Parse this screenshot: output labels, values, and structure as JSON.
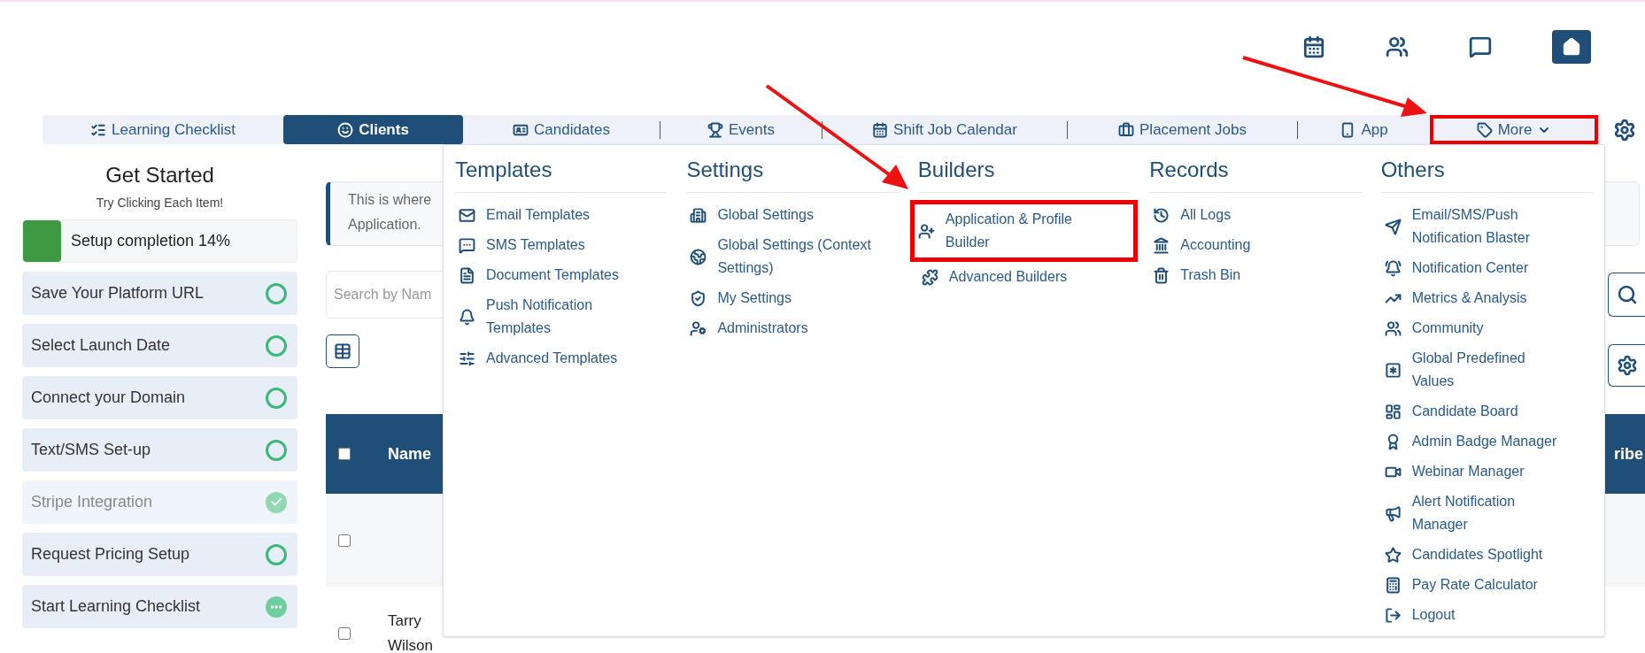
{
  "tabs": [
    {
      "label": "Learning Checklist",
      "selected": false,
      "highlighted": false
    },
    {
      "label": "Clients",
      "selected": true,
      "highlighted": false
    },
    {
      "label": "Candidates",
      "selected": false,
      "highlighted": false
    },
    {
      "label": "Events",
      "selected": false,
      "highlighted": false
    },
    {
      "label": "Shift Job Calendar",
      "selected": false,
      "highlighted": false
    },
    {
      "label": "Placement Jobs",
      "selected": false,
      "highlighted": false
    },
    {
      "label": "App",
      "selected": false,
      "highlighted": false
    },
    {
      "label": "More",
      "selected": false,
      "highlighted": true
    }
  ],
  "sidebar": {
    "title": "Get Started",
    "subtitle": "Try Clicking Each Item!",
    "progress": {
      "label": "Setup completion 14%",
      "level": 0.14
    },
    "items": [
      {
        "label": "Save Your Platform URL",
        "kind": "open"
      },
      {
        "label": "Select Launch Date",
        "kind": "open"
      },
      {
        "label": "Connect your Domain",
        "kind": "open"
      },
      {
        "label": "Text/SMS Set-up",
        "kind": "open"
      },
      {
        "label": "Stripe Integration",
        "kind": "done"
      },
      {
        "label": "Request Pricing Setup",
        "kind": "open"
      },
      {
        "label": "Start Learning Checklist",
        "kind": "pending"
      }
    ]
  },
  "notice": {
    "lines": [
      "This is where",
      "Application."
    ]
  },
  "search": {
    "placeholder": "Search by Nam"
  },
  "table": {
    "header_checked": false,
    "columns": [
      "Name",
      "ribe"
    ],
    "rows": [
      {
        "checked": false
      },
      {
        "name": "Tarry Wilson",
        "checked": false
      }
    ]
  },
  "menu": {
    "sections": [
      {
        "title": "Templates",
        "items": [
          {
            "label": "Email Templates",
            "highlighted": false
          },
          {
            "label": "SMS Templates",
            "highlighted": false
          },
          {
            "label": "Document Templates",
            "highlighted": false
          },
          {
            "label": "Push Notification Templates",
            "highlighted": false
          },
          {
            "label": "Advanced Templates",
            "highlighted": false
          }
        ]
      },
      {
        "title": "Settings",
        "items": [
          {
            "label": "Global Settings",
            "highlighted": false
          },
          {
            "label": "Global Settings (Context Settings)",
            "highlighted": false
          },
          {
            "label": "My Settings",
            "highlighted": false
          },
          {
            "label": "Administrators",
            "highlighted": false
          }
        ]
      },
      {
        "title": "Builders",
        "items": [
          {
            "label": "Application & Profile Builder",
            "highlighted": true
          },
          {
            "label": "Advanced Builders",
            "highlighted": false
          }
        ]
      },
      {
        "title": "Records",
        "items": [
          {
            "label": "All Logs",
            "highlighted": false
          },
          {
            "label": "Accounting",
            "highlighted": false
          },
          {
            "label": "Trash Bin",
            "highlighted": false
          }
        ]
      },
      {
        "title": "Others",
        "items": [
          {
            "label": "Email/SMS/Push Notification Blaster",
            "highlighted": false
          },
          {
            "label": "Notification Center",
            "highlighted": false
          },
          {
            "label": "Metrics & Analysis",
            "highlighted": false
          },
          {
            "label": "Community",
            "highlighted": false
          },
          {
            "label": "Global Predefined Values",
            "highlighted": false
          },
          {
            "label": "Candidate Board",
            "highlighted": false
          },
          {
            "label": "Admin Badge Manager",
            "highlighted": false
          },
          {
            "label": "Webinar Manager",
            "highlighted": false
          },
          {
            "label": "Alert Notification Manager",
            "highlighted": false
          },
          {
            "label": "Candidates Spotlight",
            "highlighted": false
          },
          {
            "label": "Pay Rate Calculator",
            "highlighted": false
          },
          {
            "label": "Logout",
            "highlighted": false
          }
        ]
      }
    ]
  }
}
